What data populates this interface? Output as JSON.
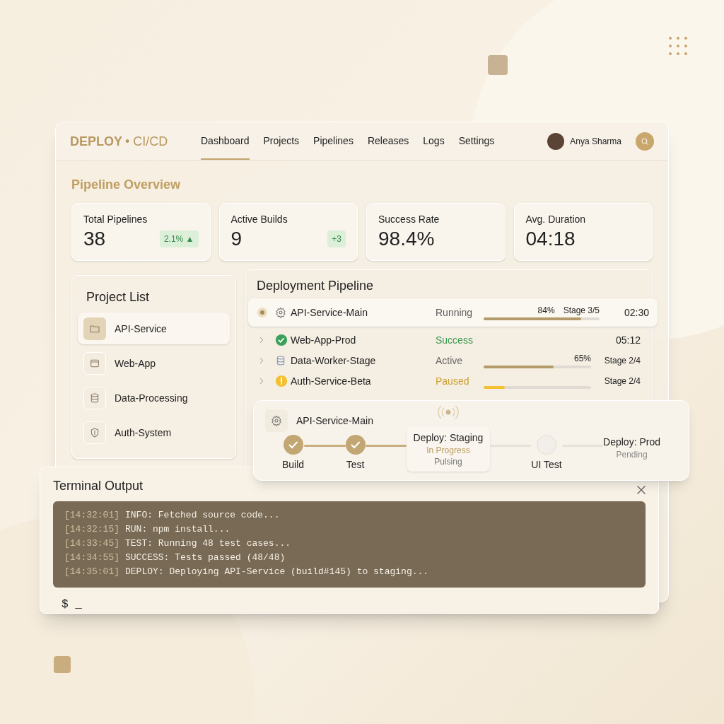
{
  "brand": {
    "name": "DEPLOY",
    "suffix": "• CI/CD"
  },
  "nav": [
    {
      "label": "Dashboard",
      "selected": true
    },
    {
      "label": "Projects",
      "selected": false
    },
    {
      "label": "Pipelines",
      "selected": false
    },
    {
      "label": "Releases",
      "selected": false
    },
    {
      "label": "Logs",
      "selected": false
    },
    {
      "label": "Settings",
      "selected": false
    }
  ],
  "user": {
    "name": "Anya Sharma"
  },
  "overview": {
    "title": "Pipeline Overview",
    "stats": [
      {
        "label": "Total Pipelines",
        "value": "38",
        "badge": "2.1%",
        "arrow": "▲"
      },
      {
        "label": "Active Builds",
        "value": "9",
        "badge": "+3"
      },
      {
        "label": "Success Rate",
        "value": "98.4%"
      },
      {
        "label": "Avg. Duration",
        "value": "04:18"
      }
    ]
  },
  "projects": {
    "title": "Project List",
    "items": [
      {
        "name": "API-Service",
        "kind": "folder",
        "selected": true
      },
      {
        "name": "Web-App",
        "kind": "window",
        "selected": false
      },
      {
        "name": "Data-Processing",
        "kind": "database",
        "selected": false
      },
      {
        "name": "Auth-System",
        "kind": "shield",
        "selected": false
      }
    ]
  },
  "pipeline": {
    "title": "Deployment Pipeline",
    "rows": [
      {
        "name": "API-Service-Main",
        "kind": "gear",
        "selected": true,
        "status": "Running",
        "color": "#5a5a5a",
        "level": 0.84,
        "percent": "84%",
        "stage": "Stage 3/5",
        "time": "02:30"
      },
      {
        "name": "Web-App-Prod",
        "kind": "check",
        "selected": false,
        "status": "Success",
        "color": "#3a9a50",
        "time": "05:12"
      },
      {
        "name": "Data-Worker-Stage",
        "kind": "database",
        "selected": false,
        "status": "Active",
        "color": "#666666",
        "level": 0.65,
        "percent": "65%",
        "stage": "Stage 2/4"
      },
      {
        "name": "Auth-Service-Beta",
        "kind": "warning",
        "selected": false,
        "status": "Paused",
        "color": "#c9a030",
        "level": 0.2,
        "stage": "Stage 2/4"
      }
    ]
  },
  "stage_card": {
    "title": "API-Service-Main",
    "stages": [
      {
        "label": "Build",
        "kind": "done"
      },
      {
        "label": "Test",
        "kind": "done"
      },
      {
        "label": "Deploy: Staging",
        "kind": "current",
        "detail": "In Progress",
        "note": "Pulsing"
      },
      {
        "label": "UI Test",
        "kind": "pending"
      },
      {
        "label": "Deploy: Prod",
        "kind": "queued",
        "detail": "Pending"
      }
    ]
  },
  "terminal": {
    "title": "Terminal Output",
    "lines": [
      {
        "time": "[14:32:01]",
        "text": "INFO: Fetched source code..."
      },
      {
        "time": "[14:32:15]",
        "text": "RUN: npm install..."
      },
      {
        "time": "[14:33:45]",
        "text": "TEST: Running 48 test cases..."
      },
      {
        "time": "[14:34:55]",
        "text": "SUCCESS: Tests passed (48/48)"
      },
      {
        "time": "[14:35:01]",
        "text": "DEPLOY: Deploying API-Service (build#145) to staging..."
      }
    ],
    "prompt": "$ _"
  }
}
